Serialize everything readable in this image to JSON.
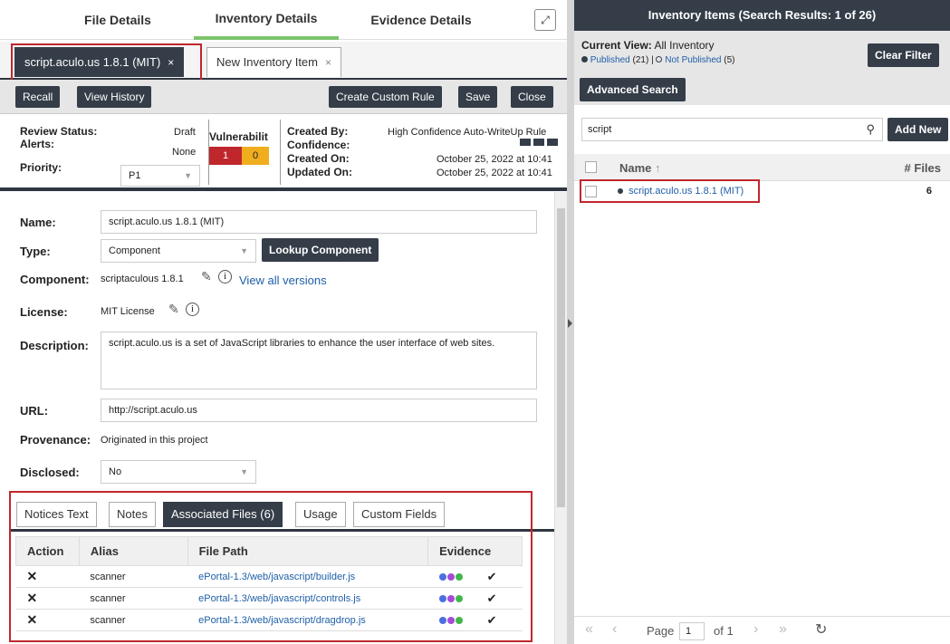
{
  "top_tabs": {
    "file_details": "File Details",
    "inventory_details": "Inventory Details",
    "evidence_details": "Evidence Details"
  },
  "item_tabs": [
    {
      "label": "script.aculo.us 1.8.1 (MIT)",
      "close": "×"
    },
    {
      "label": "New Inventory Item",
      "close": "×"
    }
  ],
  "toolbar": {
    "recall": "Recall",
    "view_history": "View History",
    "create_custom_rule": "Create Custom Rule",
    "save": "Save",
    "close": "Close"
  },
  "status": {
    "review_status_label": "Review Status:",
    "review_status_value": "Draft",
    "alerts_label": "Alerts:",
    "alerts_value": "None",
    "priority_label": "Priority:",
    "priority_value": "P1",
    "vulnerability_label": "Vulnerabilit",
    "vuln_high": "1",
    "vuln_medium": "0",
    "created_by_label": "Created By:",
    "created_by_value": "High Confidence Auto-WriteUp Rule",
    "confidence_label": "Confidence:",
    "created_on_label": "Created On:",
    "created_on_value": "October 25, 2022 at 10:41",
    "updated_on_label": "Updated On:",
    "updated_on_value": "October 25, 2022 at 10:41"
  },
  "form": {
    "name_label": "Name:",
    "name_value": "script.aculo.us 1.8.1 (MIT)",
    "type_label": "Type:",
    "type_value": "Component",
    "lookup_component": "Lookup Component",
    "component_label": "Component:",
    "component_value": "scriptaculous 1.8.1",
    "view_all_versions": "View all versions",
    "license_label": "License:",
    "license_value": "MIT License",
    "description_label": "Description:",
    "description_value": "script.aculo.us is a set of JavaScript libraries to enhance the user interface of web sites.",
    "url_label": "URL:",
    "url_value": "http://script.aculo.us",
    "provenance_label": "Provenance:",
    "provenance_value": "Originated in this project",
    "disclosed_label": "Disclosed:",
    "disclosed_value": "No"
  },
  "sub_tabs": [
    "Notices Text",
    "Notes",
    "Associated Files (6)",
    "Usage",
    "Custom Fields"
  ],
  "files_table": {
    "headers": [
      "Action",
      "Alias",
      "File Path",
      "Evidence"
    ],
    "rows": [
      {
        "alias": "scanner",
        "path": "ePortal-1.3/web/javascript/builder.js"
      },
      {
        "alias": "scanner",
        "path": "ePortal-1.3/web/javascript/controls.js"
      },
      {
        "alias": "scanner",
        "path": "ePortal-1.3/web/javascript/dragdrop.js"
      }
    ],
    "dot_colors": [
      "#4a6fe0",
      "#a64ad8",
      "#3fb84a"
    ]
  },
  "right": {
    "header": "Inventory Items (Search Results: 1 of 26)",
    "current_view_label": "Current View:",
    "current_view_value": "All Inventory",
    "published": "Published",
    "published_count": "(21)",
    "sep": "|",
    "not_published": "Not Published",
    "not_published_count": "(5)",
    "clear_filter": "Clear Filter",
    "advanced_search": "Advanced Search",
    "search_value": "script",
    "add_new": "Add New",
    "col_name": "Name",
    "col_files": "# Files",
    "row_name": "script.aculo.us 1.8.1 (MIT)",
    "row_files": "6",
    "page_label": "Page",
    "page_value": "1",
    "of_pages": "of 1"
  },
  "colors": {
    "dark": "#343d48",
    "highlight": "#c0272d",
    "link": "#1f5fa8",
    "tab_accent": "#7cc36b"
  }
}
